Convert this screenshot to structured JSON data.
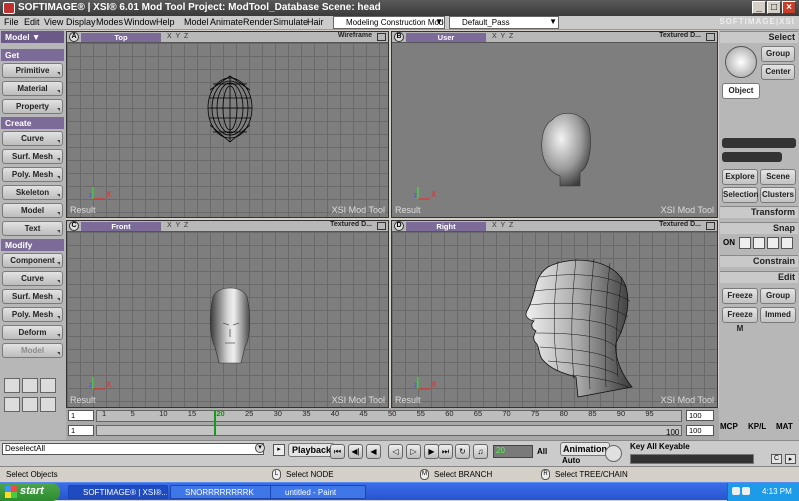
{
  "window": {
    "title": "SOFTIMAGE® | XSI® 6.01 Mod Tool Project: ModTool_Database     Scene: head",
    "brand": "SOFTIMAGE|XSI"
  },
  "menus": [
    "File",
    "Edit",
    "View",
    "Display",
    "Modes",
    "Window",
    "Help",
    "Model",
    "Animate",
    "Render",
    "Simulate",
    "Hair"
  ],
  "mode_select": "Modeling Construction Mode",
  "pass_select": "Default_Pass",
  "left_panel": {
    "dropdown": "Model",
    "get_header": "Get",
    "get_items": [
      "Primitive",
      "Material",
      "Property"
    ],
    "create_header": "Create",
    "create_items": [
      "Curve",
      "Surf. Mesh",
      "Poly. Mesh",
      "Skeleton",
      "Model",
      "Text"
    ],
    "modify_header": "Modify",
    "modify_items": [
      "Component",
      "Curve",
      "Surf. Mesh",
      "Poly. Mesh",
      "Deform",
      "Model"
    ]
  },
  "viewports": [
    {
      "letter": "A",
      "view": "Top",
      "mode": "Wireframe",
      "label_left": "Result",
      "label_right": "XSI Mod Tool"
    },
    {
      "letter": "B",
      "view": "User",
      "mode": "Textured D...",
      "label_left": "Result",
      "label_right": "XSI Mod Tool"
    },
    {
      "letter": "C",
      "view": "Front",
      "mode": "Textured D...",
      "label_left": "Result",
      "label_right": "XSI Mod Tool"
    },
    {
      "letter": "D",
      "view": "Right",
      "mode": "Textured D...",
      "label_left": "Result",
      "label_right": "XSI Mod Tool"
    }
  ],
  "viewport_icons": "X Y Z",
  "right_panel": {
    "select_header": "Select",
    "group": "Group",
    "center": "Center",
    "object": "Object",
    "explore": "Explore",
    "scene": "Scene",
    "selection": "Selection",
    "clusters": "Clusters",
    "transform_header": "Transform",
    "snap_header": "Snap",
    "snap_on": "ON",
    "constrain_header": "Constrain",
    "edit_header": "Edit",
    "freeze": "Freeze",
    "edit_group": "Group",
    "freeze_m": "Freeze M",
    "immed": "Immed"
  },
  "timeline": {
    "ticks": [
      "1",
      "5",
      "10",
      "15",
      "20",
      "25",
      "30",
      "35",
      "40",
      "45",
      "50",
      "55",
      "60",
      "65",
      "70",
      "75",
      "80",
      "85",
      "90",
      "95"
    ],
    "start": "1",
    "start2": "1",
    "end": "100",
    "end2": "100",
    "end_label": "100",
    "current_frame": 20,
    "tabs": [
      "MCP",
      "KP/L",
      "MAT"
    ]
  },
  "playback": {
    "command": "DeselectAll",
    "playback_label": "Playback",
    "frame": "20",
    "all": "All",
    "animation_label": "Animation",
    "auto": "Auto",
    "keyable": "Key All Keyable"
  },
  "status": {
    "main": "Select Objects",
    "left_mouse": "Select NODE",
    "middle_mouse": "Select BRANCH",
    "right_mouse": "Select TREE/CHAIN",
    "mouse_l": "L",
    "mouse_m": "M",
    "mouse_r": "R"
  },
  "taskbar": {
    "start": "start",
    "tasks": [
      "SOFTIMAGE® | XSI®...",
      "SNORRRRRRRRK",
      "untitled - Paint"
    ],
    "clock": "4:13 PM"
  }
}
